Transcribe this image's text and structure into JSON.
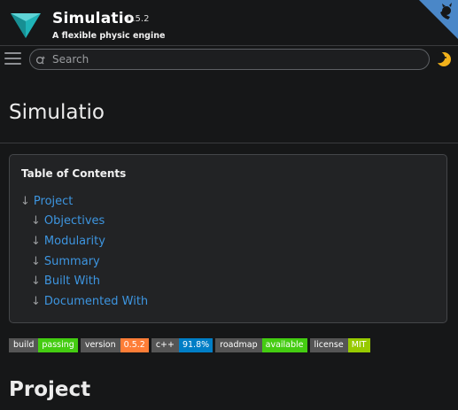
{
  "header": {
    "title": "Simulatio",
    "version": "0.5.2",
    "subtitle": "A flexible physic engine",
    "logo_icon": "triangle-logo-icon",
    "corner_icon": "github-cat-icon"
  },
  "search": {
    "placeholder": "Search",
    "value": ""
  },
  "toolbar": {
    "menu_icon": "hamburger-menu-icon",
    "theme_icon": "moon-theme-icon"
  },
  "page": {
    "title": "Simulatio"
  },
  "toc": {
    "title": "Table of Contents",
    "arrow": "↓",
    "items": [
      {
        "label": "Project",
        "level": 0
      },
      {
        "label": "Objectives",
        "level": 1
      },
      {
        "label": "Modularity",
        "level": 1
      },
      {
        "label": "Summary",
        "level": 1
      },
      {
        "label": "Built With",
        "level": 1
      },
      {
        "label": "Documented With",
        "level": 1
      }
    ]
  },
  "badges": [
    {
      "left": "build",
      "right": "passing",
      "color": "#4c1"
    },
    {
      "left": "version",
      "right": "0.5.2",
      "color": "#fe7d37"
    },
    {
      "left": "c++",
      "right": "91.8%",
      "color": "#007ec6"
    },
    {
      "left": "roadmap",
      "right": "available",
      "color": "#4c1"
    },
    {
      "left": "license",
      "right": "MIT",
      "color": "#97ca00"
    }
  ],
  "section": {
    "title": "Project"
  },
  "colors": {
    "background": "#161718",
    "link": "#3d95e0",
    "logo_teal": "#1fb3b7",
    "corner_blue": "#4a87c8"
  }
}
